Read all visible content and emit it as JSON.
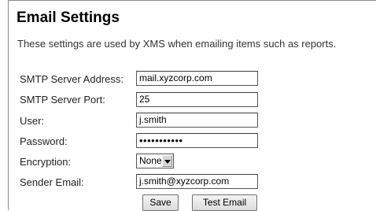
{
  "header": {
    "title": "Email Settings",
    "description": "These settings are used by XMS when emailing items such as reports."
  },
  "form": {
    "smtp_address": {
      "label": "SMTP Server Address:",
      "value": "mail.xyzcorp.com"
    },
    "smtp_port": {
      "label": "SMTP Server Port:",
      "value": "25"
    },
    "user": {
      "label": "User:",
      "value": "j.smith"
    },
    "password": {
      "label": "Password:",
      "value": "•••••••••••"
    },
    "encryption": {
      "label": "Encryption:",
      "value": "None"
    },
    "sender_email": {
      "label": "Sender Email:",
      "value": "j.smith@xyzcorp.com"
    }
  },
  "buttons": {
    "save": "Save",
    "test_email": "Test Email"
  }
}
